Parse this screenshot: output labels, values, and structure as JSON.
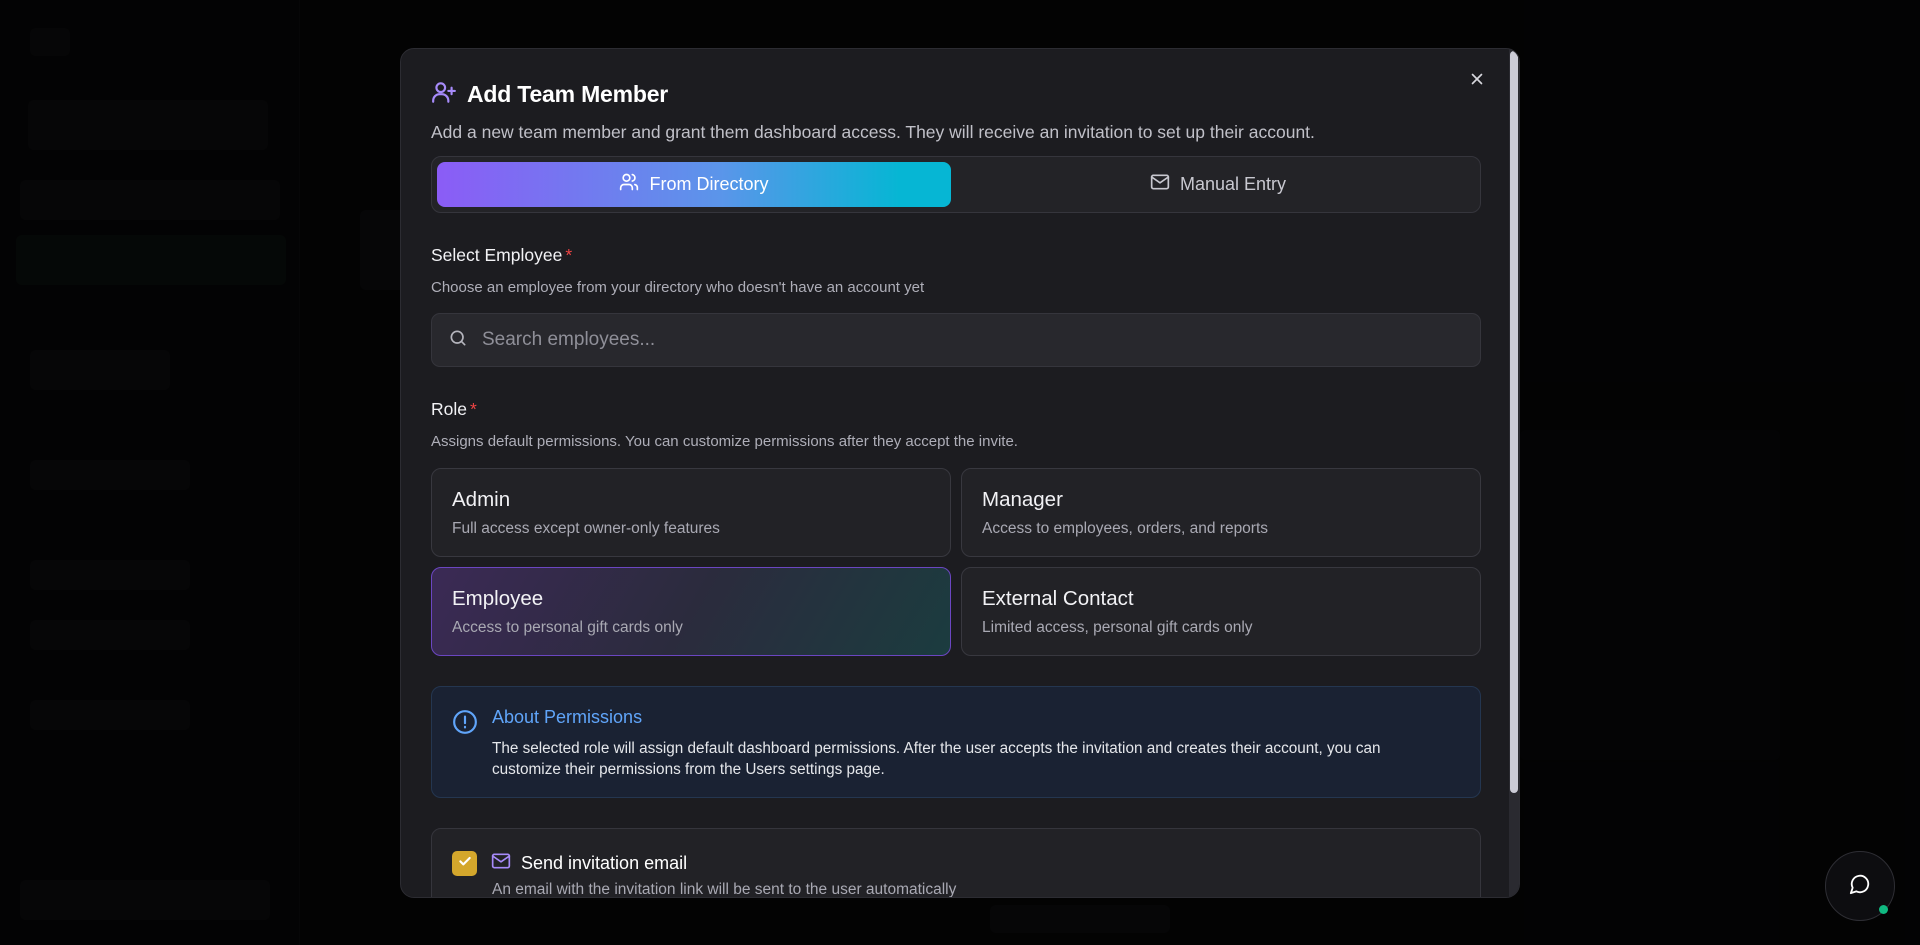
{
  "dialog": {
    "title": "Add Team Member",
    "subtitle": "Add a new team member and grant them dashboard access. They will receive an invitation to set up their account.",
    "close_icon": "close-icon",
    "title_icon": "user-plus-icon"
  },
  "tabs": [
    {
      "label": "From Directory",
      "icon": "users-icon",
      "active": true
    },
    {
      "label": "Manual Entry",
      "icon": "mail-icon",
      "active": false
    }
  ],
  "employee": {
    "label": "Select Employee",
    "required_mark": "*",
    "help": "Choose an employee from your directory who doesn't have an account yet",
    "search_placeholder": "Search employees...",
    "search_value": ""
  },
  "role": {
    "label": "Role",
    "required_mark": "*",
    "help": "Assigns default permissions. You can customize permissions after they accept the invite.",
    "options": [
      {
        "name": "Admin",
        "desc": "Full access except owner-only features",
        "selected": false
      },
      {
        "name": "Manager",
        "desc": "Access to employees, orders, and reports",
        "selected": false
      },
      {
        "name": "Employee",
        "desc": "Access to personal gift cards only",
        "selected": true
      },
      {
        "name": "External Contact",
        "desc": "Limited access, personal gift cards only",
        "selected": false
      }
    ]
  },
  "permissions_info": {
    "title": "About Permissions",
    "text": "The selected role will assign default dashboard permissions. After the user accepts the invitation and creates their account, you can customize their permissions from the Users settings page.",
    "icon": "info-circle-icon"
  },
  "invitation": {
    "label": "Send invitation email",
    "desc": "An email with the invitation link will be sent to the user automatically",
    "checked": true
  },
  "colors": {
    "accent_purple": "#8b5cf6",
    "accent_cyan": "#06b6d4",
    "info_blue": "#60a5fa",
    "checkbox_gold": "#d4a72c",
    "required_red": "#ef4444"
  }
}
